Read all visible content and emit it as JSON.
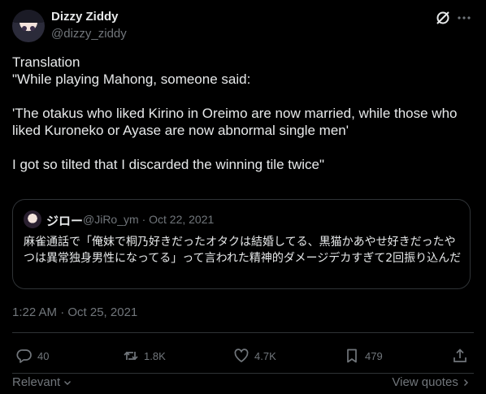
{
  "author": {
    "name": "Dizzy Ziddy",
    "handle": "@dizzy_ziddy"
  },
  "body": {
    "text": "Translation\n\"While playing Mahong, someone said:\n\n'The otakus who liked Kirino in Oreimo are now married, while those who liked Kuroneko or Ayase are now abnormal single men'\n\nI got so tilted that I discarded the winning tile twice\""
  },
  "quote": {
    "name": "ジロー",
    "handle": "@JiRo_ym",
    "sep": "·",
    "date": "Oct 22, 2021",
    "text": "麻雀通話で「俺妹で桐乃好きだったオタクは結婚してる、黒猫かあやせ好きだったやつは異常独身男性になってる」って言われた精神的ダメージデカすぎて2回振り込んだ"
  },
  "timestamp": "1:22 AM · Oct 25, 2021",
  "actions": {
    "replies": "40",
    "reposts": "1.8K",
    "likes": "4.7K",
    "bookmarks": "479"
  },
  "footer": {
    "relevant": "Relevant",
    "view_quotes": "View quotes"
  },
  "icons": [
    "grok-icon",
    "more-icon",
    "reply-icon",
    "repost-icon",
    "like-icon",
    "bookmark-icon",
    "share-icon",
    "chevron-down-icon",
    "chevron-right-icon"
  ]
}
